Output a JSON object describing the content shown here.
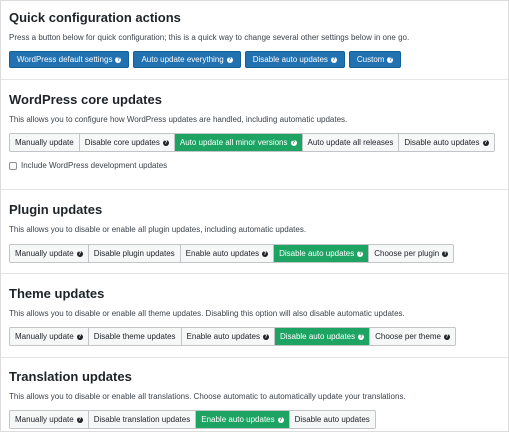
{
  "quick": {
    "title": "Quick configuration actions",
    "description": "Press a button below for quick configuration; this is a quick way to change several other settings below in one go.",
    "buttons": [
      {
        "label": "WordPress default settings",
        "help": "?"
      },
      {
        "label": "Auto update everything",
        "help": "?"
      },
      {
        "label": "Disable auto updates",
        "help": "?"
      },
      {
        "label": "Custom",
        "help": "?"
      }
    ]
  },
  "core": {
    "title": "WordPress core updates",
    "description": "This allows you to configure how WordPress updates are handled, including automatic updates.",
    "options": [
      {
        "label": "Manually update",
        "help": "",
        "active": false
      },
      {
        "label": "Disable core updates",
        "help": "?",
        "active": false
      },
      {
        "label": "Auto update all minor versions",
        "help": "?",
        "active": true
      },
      {
        "label": "Auto update all releases",
        "help": "",
        "active": false
      },
      {
        "label": "Disable auto updates",
        "help": "?",
        "active": false
      }
    ],
    "dev_checkbox_label": "Include WordPress development updates"
  },
  "plugin": {
    "title": "Plugin updates",
    "description": "This allows you to disable or enable all plugin updates, including automatic updates.",
    "options": [
      {
        "label": "Manually update",
        "help": "?",
        "active": false
      },
      {
        "label": "Disable plugin updates",
        "help": "",
        "active": false
      },
      {
        "label": "Enable auto updates",
        "help": "?",
        "active": false
      },
      {
        "label": "Disable auto updates",
        "help": "?",
        "active": true
      },
      {
        "label": "Choose per plugin",
        "help": "?",
        "active": false
      }
    ]
  },
  "theme": {
    "title": "Theme updates",
    "description": "This allows you to disable or enable all theme updates. Disabling this option will also disable automatic updates.",
    "options": [
      {
        "label": "Manually update",
        "help": "?",
        "active": false
      },
      {
        "label": "Disable theme updates",
        "help": "",
        "active": false
      },
      {
        "label": "Enable auto updates",
        "help": "?",
        "active": false
      },
      {
        "label": "Disable auto updates",
        "help": "?",
        "active": true
      },
      {
        "label": "Choose per theme",
        "help": "?",
        "active": false
      }
    ]
  },
  "translation": {
    "title": "Translation updates",
    "description": "This allows you to disable or enable all translations. Choose automatic to automatically update your translations.",
    "options": [
      {
        "label": "Manually update",
        "help": "?",
        "active": false
      },
      {
        "label": "Disable translation updates",
        "help": "",
        "active": false
      },
      {
        "label": "Enable auto updates",
        "help": "?",
        "active": true
      },
      {
        "label": "Disable auto updates",
        "help": "",
        "active": false
      }
    ]
  },
  "colors": {
    "primary": "#2271b1",
    "active": "#1da463"
  }
}
